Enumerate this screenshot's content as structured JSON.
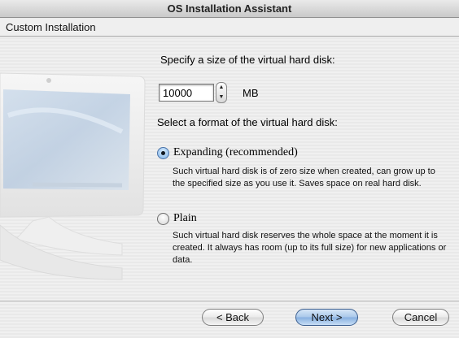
{
  "window": {
    "title": "OS Installation Assistant"
  },
  "header": {
    "title": "Custom Installation"
  },
  "disk_size": {
    "prompt": "Specify a size of the virtual hard disk:",
    "value": "10000",
    "unit": "MB"
  },
  "disk_format": {
    "prompt": "Select a format of the virtual hard disk:",
    "options": [
      {
        "label": "Expanding (recommended)",
        "selected": true,
        "description": "Such virtual hard disk is of zero size when created, can grow up to the specified size as you use it. Saves space on real hard disk."
      },
      {
        "label": "Plain",
        "selected": false,
        "description": "Such virtual hard disk reserves the whole space at the moment it is created. It always has room (up to its full size) for new applications or data."
      }
    ]
  },
  "buttons": {
    "back": "< Back",
    "next": "Next >",
    "cancel": "Cancel"
  },
  "colors": {
    "accent": "#86afe0",
    "window_bg": "#ececec"
  }
}
